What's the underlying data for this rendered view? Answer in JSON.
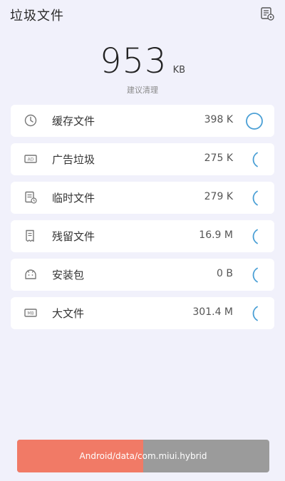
{
  "header": {
    "title": "垃圾文件",
    "icon": "file-settings-icon"
  },
  "summary": {
    "value": "953",
    "unit": "KB",
    "note": "建议清理"
  },
  "items": [
    {
      "label": "缓存文件",
      "size": "398 K",
      "icon": "clock-icon",
      "status": "complete-icon"
    },
    {
      "label": "广告垃圾",
      "size": "275 K",
      "icon": "ad-icon",
      "status": "loading-spinner-icon"
    },
    {
      "label": "临时文件",
      "size": "279 K",
      "icon": "temp-file-icon",
      "status": "loading-spinner-icon"
    },
    {
      "label": "残留文件",
      "size": "16.9 M",
      "icon": "residual-file-icon",
      "status": "loading-spinner-icon"
    },
    {
      "label": "安装包",
      "size": "0 B",
      "icon": "android-icon",
      "status": "loading-spinner-icon"
    },
    {
      "label": "大文件",
      "size": "301.4 M",
      "icon": "large-file-icon",
      "status": "loading-spinner-icon"
    }
  ],
  "scan": {
    "path": "Android/data/com.miui.hybrid",
    "progress": 0.5
  },
  "colors": {
    "accent": "#4a9fd5",
    "progress_fill": "#f17a66",
    "progress_track": "#9b9b9b"
  }
}
